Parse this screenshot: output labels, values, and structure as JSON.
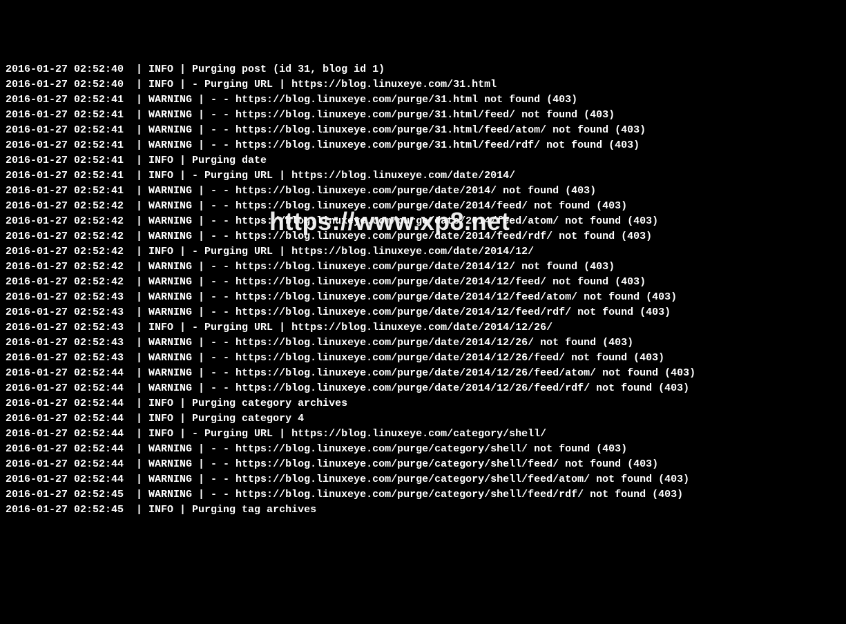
{
  "watermark": "https://www.xp8.net",
  "lines": [
    {
      "ts": "2016-01-27 02:52:40",
      "lvl": "INFO",
      "msg": "Purging post (id 31, blog id 1)"
    },
    {
      "ts": "2016-01-27 02:52:40",
      "lvl": "INFO",
      "msg": "- Purging URL | https://blog.linuxeye.com/31.html"
    },
    {
      "ts": "2016-01-27 02:52:41",
      "lvl": "WARNING",
      "msg": "- - https://blog.linuxeye.com/purge/31.html not found (403)"
    },
    {
      "ts": "2016-01-27 02:52:41",
      "lvl": "WARNING",
      "msg": "- - https://blog.linuxeye.com/purge/31.html/feed/ not found (403)"
    },
    {
      "ts": "2016-01-27 02:52:41",
      "lvl": "WARNING",
      "msg": "- - https://blog.linuxeye.com/purge/31.html/feed/atom/ not found (403)"
    },
    {
      "ts": "2016-01-27 02:52:41",
      "lvl": "WARNING",
      "msg": "- - https://blog.linuxeye.com/purge/31.html/feed/rdf/ not found (403)"
    },
    {
      "ts": "2016-01-27 02:52:41",
      "lvl": "INFO",
      "msg": "Purging date"
    },
    {
      "ts": "2016-01-27 02:52:41",
      "lvl": "INFO",
      "msg": "- Purging URL | https://blog.linuxeye.com/date/2014/"
    },
    {
      "ts": "2016-01-27 02:52:41",
      "lvl": "WARNING",
      "msg": "- - https://blog.linuxeye.com/purge/date/2014/ not found (403)"
    },
    {
      "ts": "2016-01-27 02:52:42",
      "lvl": "WARNING",
      "msg": "- - https://blog.linuxeye.com/purge/date/2014/feed/ not found (403)"
    },
    {
      "ts": "2016-01-27 02:52:42",
      "lvl": "WARNING",
      "msg": "- - https://blog.linuxeye.com/purge/date/2014/feed/atom/ not found (403)"
    },
    {
      "ts": "2016-01-27 02:52:42",
      "lvl": "WARNING",
      "msg": "- - https://blog.linuxeye.com/purge/date/2014/feed/rdf/ not found (403)"
    },
    {
      "ts": "2016-01-27 02:52:42",
      "lvl": "INFO",
      "msg": "- Purging URL | https://blog.linuxeye.com/date/2014/12/"
    },
    {
      "ts": "2016-01-27 02:52:42",
      "lvl": "WARNING",
      "msg": "- - https://blog.linuxeye.com/purge/date/2014/12/ not found (403)"
    },
    {
      "ts": "2016-01-27 02:52:42",
      "lvl": "WARNING",
      "msg": "- - https://blog.linuxeye.com/purge/date/2014/12/feed/ not found (403)"
    },
    {
      "ts": "2016-01-27 02:52:43",
      "lvl": "WARNING",
      "msg": "- - https://blog.linuxeye.com/purge/date/2014/12/feed/atom/ not found (403)"
    },
    {
      "ts": "2016-01-27 02:52:43",
      "lvl": "WARNING",
      "msg": "- - https://blog.linuxeye.com/purge/date/2014/12/feed/rdf/ not found (403)"
    },
    {
      "ts": "2016-01-27 02:52:43",
      "lvl": "INFO",
      "msg": "- Purging URL | https://blog.linuxeye.com/date/2014/12/26/"
    },
    {
      "ts": "2016-01-27 02:52:43",
      "lvl": "WARNING",
      "msg": "- - https://blog.linuxeye.com/purge/date/2014/12/26/ not found (403)"
    },
    {
      "ts": "2016-01-27 02:52:43",
      "lvl": "WARNING",
      "msg": "- - https://blog.linuxeye.com/purge/date/2014/12/26/feed/ not found (403)"
    },
    {
      "ts": "2016-01-27 02:52:44",
      "lvl": "WARNING",
      "msg": "- - https://blog.linuxeye.com/purge/date/2014/12/26/feed/atom/ not found (403)"
    },
    {
      "ts": "2016-01-27 02:52:44",
      "lvl": "WARNING",
      "msg": "- - https://blog.linuxeye.com/purge/date/2014/12/26/feed/rdf/ not found (403)"
    },
    {
      "ts": "2016-01-27 02:52:44",
      "lvl": "INFO",
      "msg": "Purging category archives"
    },
    {
      "ts": "2016-01-27 02:52:44",
      "lvl": "INFO",
      "msg": "Purging category 4"
    },
    {
      "ts": "2016-01-27 02:52:44",
      "lvl": "INFO",
      "msg": "- Purging URL | https://blog.linuxeye.com/category/shell/"
    },
    {
      "ts": "2016-01-27 02:52:44",
      "lvl": "WARNING",
      "msg": "- - https://blog.linuxeye.com/purge/category/shell/ not found (403)"
    },
    {
      "ts": "2016-01-27 02:52:44",
      "lvl": "WARNING",
      "msg": "- - https://blog.linuxeye.com/purge/category/shell/feed/ not found (403)"
    },
    {
      "ts": "2016-01-27 02:52:44",
      "lvl": "WARNING",
      "msg": "- - https://blog.linuxeye.com/purge/category/shell/feed/atom/ not found (403)"
    },
    {
      "ts": "2016-01-27 02:52:45",
      "lvl": "WARNING",
      "msg": "- - https://blog.linuxeye.com/purge/category/shell/feed/rdf/ not found (403)"
    },
    {
      "ts": "2016-01-27 02:52:45",
      "lvl": "INFO",
      "msg": "Purging tag archives"
    }
  ]
}
